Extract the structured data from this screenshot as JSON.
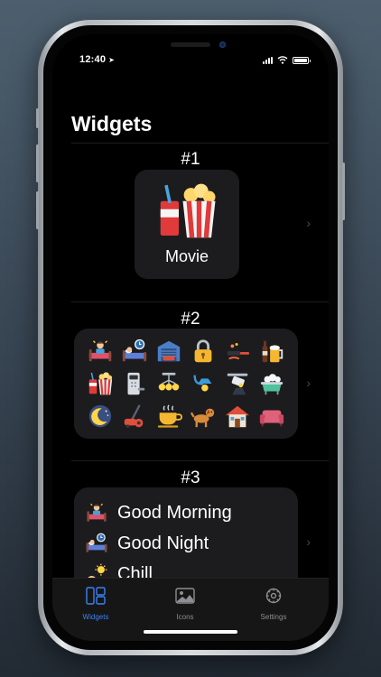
{
  "status": {
    "time": "12:40"
  },
  "page": {
    "title": "Widgets"
  },
  "sections": [
    {
      "number": "#1",
      "label": "Movie"
    },
    {
      "number": "#2"
    },
    {
      "number": "#3"
    }
  ],
  "list_widget": {
    "items": [
      {
        "label": "Good Morning",
        "icon": "wake-up-bed-icon"
      },
      {
        "label": "Good Night",
        "icon": "sleeping-bed-icon"
      },
      {
        "label": "Chill",
        "icon": "sun-hand-icon"
      }
    ]
  },
  "grid_icons": [
    "wake-up-bed-icon",
    "sleeping-bed-icon",
    "garage-icon",
    "padlock-icon",
    "stove-pan-icon",
    "beer-bottle-icon",
    "movie-popcorn-icon",
    "door-lock-icon",
    "ceiling-lights-icon",
    "ceiling-lamp-icon",
    "spotlight-icon",
    "bathtub-icon",
    "moon-night-icon",
    "vacuum-cleaner-icon",
    "coffee-cup-icon",
    "dog-icon",
    "house-icon",
    "sofa-icon"
  ],
  "tabs": [
    {
      "label": "Widgets",
      "icon": "widgets-icon",
      "active": true
    },
    {
      "label": "Icons",
      "icon": "image-icon",
      "active": false
    },
    {
      "label": "Settings",
      "icon": "gear-icon",
      "active": false
    }
  ],
  "colors": {
    "accent": "#3b82f6",
    "card": "#1c1c1e",
    "background": "#000000"
  }
}
